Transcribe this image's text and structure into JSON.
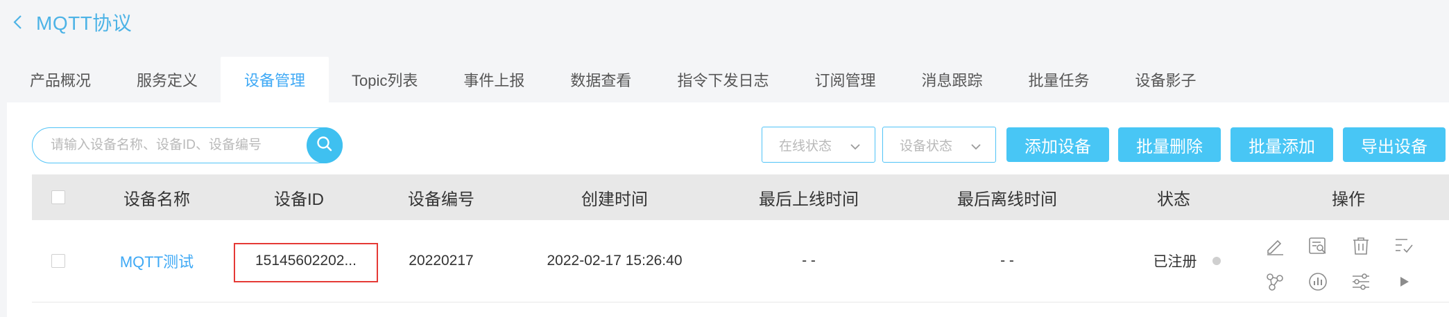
{
  "header": {
    "title": "MQTT协议",
    "back_icon": "chevron-left-icon"
  },
  "tabs": [
    {
      "label": "产品概况",
      "active": false
    },
    {
      "label": "服务定义",
      "active": false
    },
    {
      "label": "设备管理",
      "active": true
    },
    {
      "label": "Topic列表",
      "active": false
    },
    {
      "label": "事件上报",
      "active": false
    },
    {
      "label": "数据查看",
      "active": false
    },
    {
      "label": "指令下发日志",
      "active": false
    },
    {
      "label": "订阅管理",
      "active": false
    },
    {
      "label": "消息跟踪",
      "active": false
    },
    {
      "label": "批量任务",
      "active": false
    },
    {
      "label": "设备影子",
      "active": false
    }
  ],
  "toolbar": {
    "search_placeholder": "请输入设备名称、设备ID、设备编号",
    "search_icon": "search-icon",
    "online_status_placeholder": "在线状态",
    "device_status_placeholder": "设备状态",
    "add_device": "添加设备",
    "batch_delete": "批量删除",
    "batch_add": "批量添加",
    "export_device": "导出设备"
  },
  "table": {
    "headers": {
      "name": "设备名称",
      "id": "设备ID",
      "number": "设备编号",
      "created": "创建时间",
      "last_online": "最后上线时间",
      "last_offline": "最后离线时间",
      "status": "状态",
      "actions": "操作"
    },
    "rows": [
      {
        "name": "MQTT测试",
        "id": "15145602202...",
        "number": "20220217",
        "created": "2022-02-17 15:26:40",
        "last_online": "- -",
        "last_offline": "- -",
        "status": "已注册",
        "actions": [
          "edit-icon",
          "detail-search-icon",
          "delete-icon",
          "checklist-icon",
          "topology-icon",
          "chart-icon",
          "settings-sliders-icon",
          "play-icon"
        ]
      }
    ]
  },
  "colors": {
    "accent": "#3fa9f5",
    "button": "#48c6f5",
    "highlight": "#e53935"
  }
}
